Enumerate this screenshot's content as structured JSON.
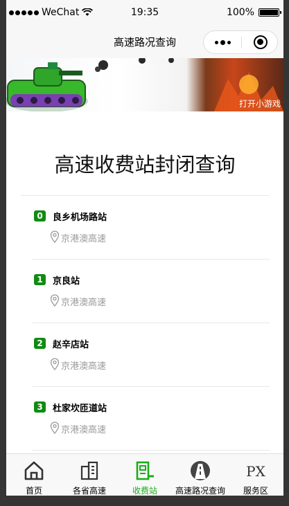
{
  "status": {
    "carrier": "WeChat",
    "time": "19:35",
    "battery": "100%"
  },
  "navbar": {
    "title": "高速路况查询"
  },
  "banner": {
    "ad_label": "打开小游戏"
  },
  "page": {
    "heading": "高速收费站封闭查询"
  },
  "stations": [
    {
      "index": "0",
      "name": "良乡机场路站",
      "road": "京港澳高速"
    },
    {
      "index": "1",
      "name": "京良站",
      "road": "京港澳高速"
    },
    {
      "index": "2",
      "name": "赵辛店站",
      "road": "京港澳高速"
    },
    {
      "index": "3",
      "name": "杜家坎匝道站",
      "road": "京港澳高速"
    }
  ],
  "tabs": [
    {
      "label": "首页",
      "icon": "home-icon"
    },
    {
      "label": "各省高速",
      "icon": "building-icon"
    },
    {
      "label": "收费站",
      "icon": "toll-station-icon",
      "active": true
    },
    {
      "label": "高速路况查询",
      "icon": "highway-icon"
    },
    {
      "label": "服务区",
      "icon": "px-icon"
    }
  ],
  "colors": {
    "accent": "#19ad19",
    "badge": "#118b11"
  }
}
